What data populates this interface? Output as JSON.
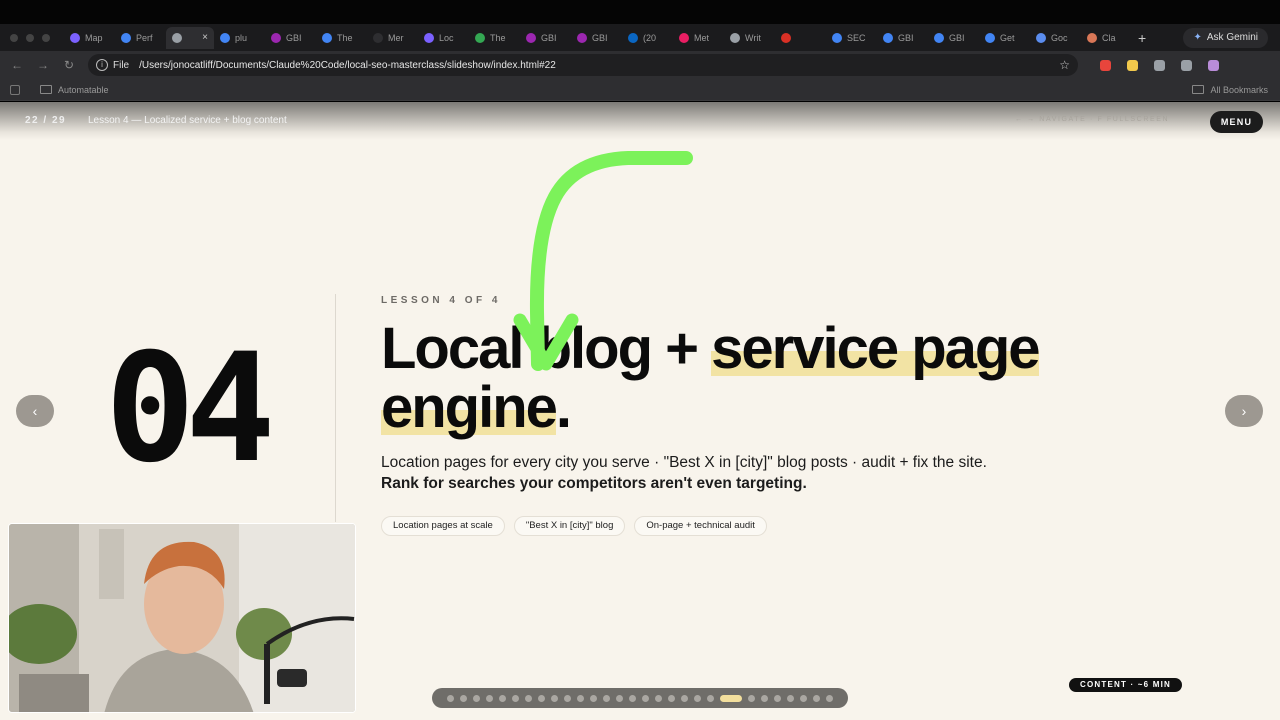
{
  "browser": {
    "tabs": [
      {
        "label": "Map",
        "color": "#7b61ff"
      },
      {
        "label": "Perf",
        "color": "#4285f4"
      },
      {
        "label": "",
        "color": "#9aa0a6",
        "active": true
      },
      {
        "label": "plu",
        "color": "#4285f4"
      },
      {
        "label": "GBI",
        "color": "#9c27b0"
      },
      {
        "label": "The",
        "color": "#4285f4"
      },
      {
        "label": "Mer",
        "color": "#2e2e31"
      },
      {
        "label": "Loc",
        "color": "#7b61ff"
      },
      {
        "label": "The",
        "color": "#34a853"
      },
      {
        "label": "GBI",
        "color": "#9c27b0"
      },
      {
        "label": "GBI",
        "color": "#9c27b0"
      },
      {
        "label": "(20",
        "color": "#0a66c2"
      },
      {
        "label": "Met",
        "color": "#e91e63"
      },
      {
        "label": "Writ",
        "color": "#9aa0a6"
      },
      {
        "label": "",
        "color": "#d93025"
      },
      {
        "label": "SEC",
        "color": "#4285f4"
      },
      {
        "label": "GBI",
        "color": "#4285f4"
      },
      {
        "label": "GBI",
        "color": "#4285f4"
      },
      {
        "label": "Get",
        "color": "#4285f4"
      },
      {
        "label": "Goc",
        "color": "#5b8def"
      },
      {
        "label": "Cla",
        "color": "#d97757"
      }
    ],
    "new_tab": "+",
    "gemini_label": "Ask Gemini",
    "url_scheme": "File",
    "url": "/Users/jonocatliff/Documents/Claude%20Code/local-seo-masterclass/slideshow/index.html#22",
    "bookmark_folder": "Automatable",
    "all_bookmarks": "All Bookmarks",
    "extension_colors": [
      "#e8453c",
      "#f2c94c",
      "#9aa0a6",
      "#9aa0a6",
      "#b98cd8"
    ]
  },
  "slide": {
    "counter": "22 / 29",
    "lesson_label": "Lesson 4 — Localized service + blog content",
    "nav_hint": "← → NAVIGATE · F FULLSCREEN",
    "menu": "MENU",
    "number": "04",
    "eyebrow": "LESSON 4 OF 4",
    "title_part1": "Local blog + ",
    "title_highlight1": "service page",
    "title_highlight2": "engine",
    "title_end": ".",
    "lede": "Location pages for every city you serve · \"Best X in [city]\" blog posts · audit + fix the site. ",
    "lede_bold": "Rank for searches your competitors aren't even targeting.",
    "chips": [
      "Location pages at scale",
      "\"Best X in [city]\" blog",
      "On-page + technical audit"
    ],
    "prev": "‹",
    "next": "›",
    "total_dots": 29,
    "active_dot": 22,
    "badge": "CONTENT · ~6 MIN",
    "accent": "#f2e3a4",
    "arrow_color": "#7cf25a"
  }
}
